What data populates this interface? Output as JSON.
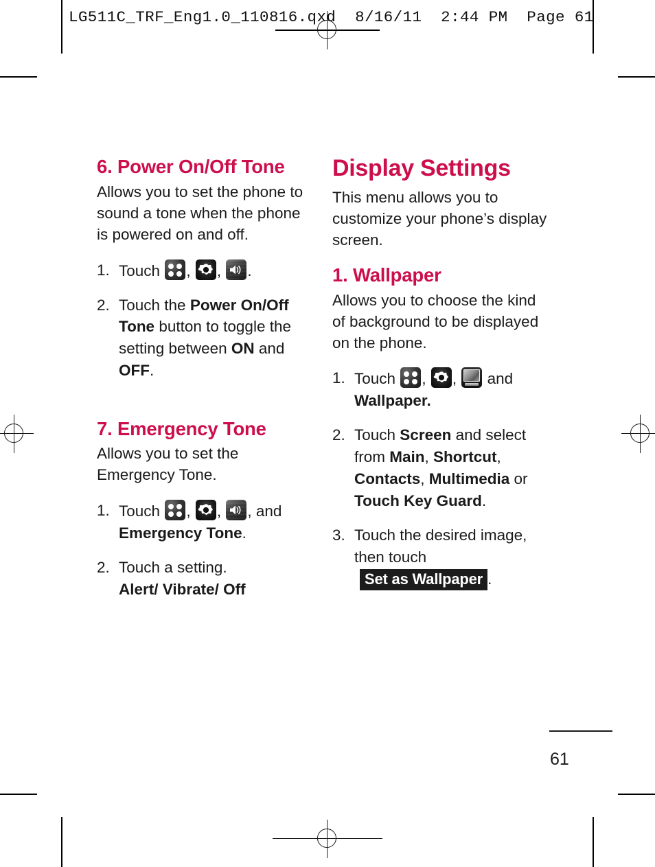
{
  "document": {
    "slug": "LG511C_TRF_Eng1.0_110816.qxd  8/16/11  2:44 PM  Page 61",
    "page_number": "61"
  },
  "left_column": {
    "section_6": {
      "heading": "6. Power On/Off Tone",
      "intro": "Allows you to set the phone to sound a tone when the phone is powered on and off.",
      "step1": {
        "num": "1.",
        "text_before": "Touch",
        "sep1": ",",
        "sep2": ",",
        "text_after": "."
      },
      "step2": {
        "num": "2.",
        "t1": "Touch the ",
        "b1": "Power On/Off Tone",
        "t2": " button to toggle the setting between ",
        "b2": "ON",
        "t3": " and ",
        "b3": "OFF",
        "t4": "."
      }
    },
    "section_7": {
      "heading": "7. Emergency Tone",
      "intro": "Allows you to set the Emergency Tone.",
      "step1": {
        "num": "1.",
        "text_before": "Touch",
        "sep1": ",",
        "sep2": ",",
        "text_after": ", and",
        "bold_tail": "Emergency Tone",
        "period": "."
      },
      "step2": {
        "num": "2.",
        "t1": "Touch a setting.",
        "b1": "Alert/ Vibrate/ Off"
      }
    }
  },
  "right_column": {
    "major_heading": "Display Settings",
    "intro": "This menu allows you to customize your phone’s display screen.",
    "section_1": {
      "heading": "1. Wallpaper",
      "intro": "Allows you to choose the kind of background to be displayed on the phone.",
      "step1": {
        "num": "1.",
        "text_before": "Touch",
        "sep1": ",",
        "sep2": ",",
        "text_after": "and",
        "bold_tail": "Wallpaper."
      },
      "step2": {
        "num": "2.",
        "t1": "Touch ",
        "b1": "Screen",
        "t2": " and select from ",
        "b2": "Main",
        "t3": ", ",
        "b3": "Shortcut",
        "t4": ", ",
        "b4": "Contacts",
        "t5": ", ",
        "b5": "Multimedia",
        "t6": " or ",
        "b6": "Touch Key Guard",
        "t7": "."
      },
      "step3": {
        "num": "3.",
        "t1": "Touch the desired image, then touch",
        "chip": "Set as Wallpaper",
        "t2": "."
      }
    }
  },
  "icons": {
    "grid": "apps-grid-icon",
    "gear": "settings-gear-icon",
    "speaker": "sound-speaker-icon",
    "display": "display-screen-icon"
  },
  "colors": {
    "heading": "#cd0e4c",
    "text": "#1a1a1a",
    "chip_bg": "#1c1c1c"
  }
}
